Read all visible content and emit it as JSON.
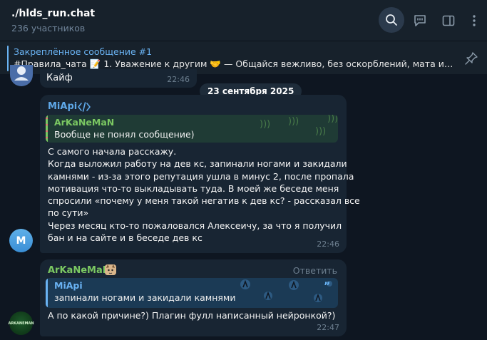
{
  "header": {
    "title": "./hlds_run.chat",
    "members": "236 участников",
    "icons": [
      "search-icon",
      "feedback-icon",
      "side-panel-icon",
      "more-icon"
    ]
  },
  "pinned": {
    "title": "Закреплённое сообщение #1",
    "text": "#Правила_чата 📝  1. Уважение к другим 🤝   — Общайся вежливо, без оскорблений, мата и д…",
    "icon": "unpin-icon"
  },
  "previous_message": {
    "text": "Кайф",
    "time": "22:46"
  },
  "date_separator": "23 сентября 2025",
  "messages": [
    {
      "sender": "MiApi",
      "avatar_letter": "M",
      "reply": {
        "name": "ArKaNeMaN",
        "text": "Вообще не понял сообщение)"
      },
      "lines": [
        "С самого начала расскажу.",
        "Когда выложил работу на дев кс, запинали ногами и закидали",
        "камнями - из-за этого репутация ушла в минус 2, после пропала",
        "мотивация что-то выкладывать туда. В моей же беседе меня",
        "спросили «почему у меня такой негатив к дев кс? - рассказал все",
        "по сути»",
        "Через месяц кто-то пожаловался Алексеичу, за что я получил",
        "бан и на сайте и в беседе дев кс"
      ],
      "time": "22:46"
    },
    {
      "sender": "ArKaNeMaN",
      "reply_action": "Ответить",
      "avatar_text": "ARKANEMAN",
      "reply": {
        "name": "MiApi",
        "text": "запинали ногами и закидали камнями"
      },
      "text": "А по какой причине?) Плагин фулл написанный нейронкой?)",
      "time": "22:47"
    }
  ],
  "colors": {
    "background": "#0e1621",
    "header": "#17212b",
    "bubble": "#182533",
    "accent": "#6ab3f3",
    "green_name": "#7bc862",
    "muted": "#6d7f8f"
  }
}
